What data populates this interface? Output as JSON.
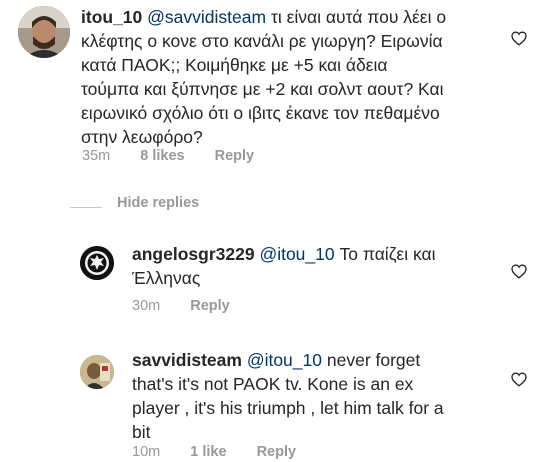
{
  "comments": [
    {
      "username": "itou_10",
      "mention": "@savvidisteam",
      "text": " τι είναι αυτά που λέει ο κλέφτης ο κονε στο κανάλι ρε γιωργη? Ειρωνία κατά ΠΑΟΚ;; Κοιμήθηκε με +5 και άδεια τούμπα και ξύπνησε με +2 και σολντ αουτ? Και ειρωνικό σχόλιο ότι ο ιβιτς έκανε τον πεθαμένο στην λεωφόρο?",
      "lines": [
        "τι είναι αυτά που λέει ο",
        "κλέφτης ο κονε στο κανάλι ρε γιωργη? Ειρωνία",
        "κατά ΠΑΟΚ;; Κοιμήθηκε με +5 και άδεια",
        "τούμπα και ξύπνησε με +2 και σολντ αουτ? Και",
        "ειρωνικό σχόλιο ότι ο ιβιτς έκανε τον πεθαμένο",
        "στην λεωφόρο?"
      ],
      "time": "35m",
      "likes": "8 likes",
      "reply": "Reply"
    },
    {
      "username": "angelosgr3229",
      "mention": "@itou_10",
      "lines": [
        "Το παίζει και",
        "Έλληνας"
      ],
      "time": "30m",
      "likes": "",
      "reply": "Reply"
    },
    {
      "username": "savvidisteam",
      "mention": "@itou_10",
      "lines": [
        "never forget",
        "that's it's not PAOK tv. Kone is an ex",
        "player ,  it's his triumph , let him talk for a",
        "bit"
      ],
      "time": "10m",
      "likes": "1 like",
      "reply": "Reply"
    }
  ],
  "hide_replies": "Hide replies",
  "icons": {
    "like": "heart-outline-icon"
  },
  "colors": {
    "text": "#262626",
    "meta": "#999999",
    "heart_stroke": "#262626"
  }
}
